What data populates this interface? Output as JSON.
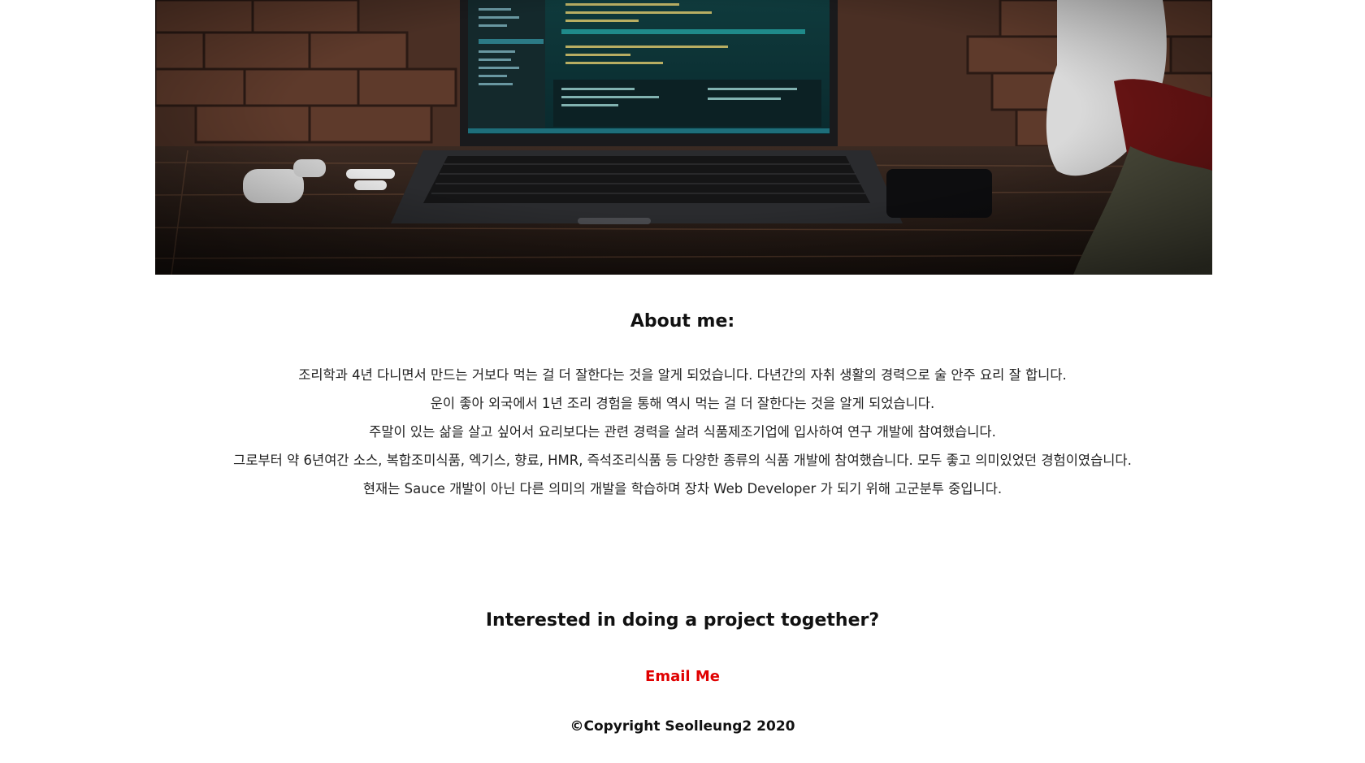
{
  "about": {
    "heading": "About me:",
    "paragraphs": [
      "조리학과 4년 다니면서 만드는 거보다 먹는 걸 더 잘한다는 것을 알게 되었습니다. 다년간의 자취 생활의 경력으로 술 안주 요리 잘 합니다.",
      "운이 좋아 외국에서 1년 조리 경험을 통해 역시 먹는 걸 더 잘한다는 것을 알게 되었습니다.",
      "주말이 있는 삶을 살고 싶어서 요리보다는 관련 경력을 살려 식품제조기업에 입사하여 연구 개발에 참여했습니다.",
      "그로부터 약 6년여간 소스, 복합조미식품, 엑기스, 향료, HMR, 즉석조리식품 등 다양한 종류의 식품 개발에 참여했습니다. 모두 좋고 의미있었던 경험이였습니다.",
      "현재는 Sauce 개발이 아닌 다른 의미의 개발을 학습하며 장차 Web Developer 가 되기 위해 고군분투 중입니다."
    ]
  },
  "contact": {
    "heading": "Interested in doing a project together?",
    "email_label": "Email Me"
  },
  "footer": {
    "copyright": "©Copyright Seolleung2 2020"
  },
  "colors": {
    "email_link": "#e00000",
    "text": "#111111",
    "background": "#ffffff"
  }
}
